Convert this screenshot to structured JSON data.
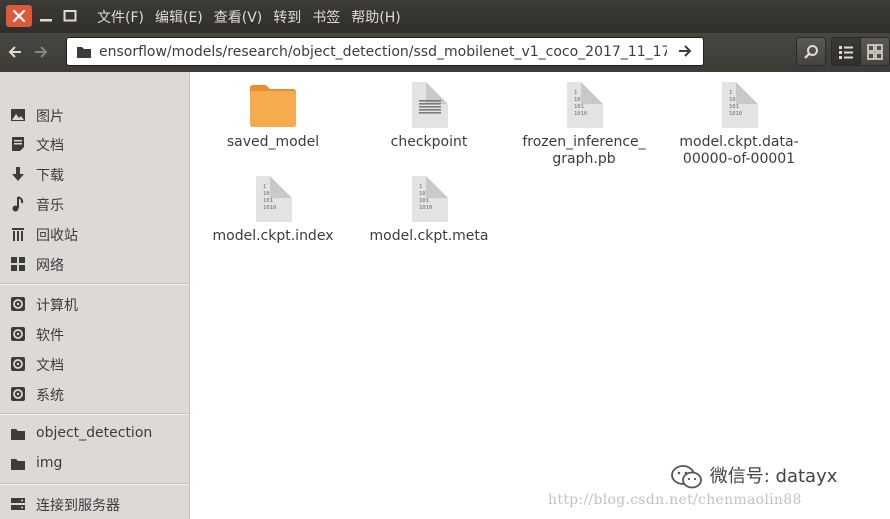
{
  "menu": [
    "文件(F)",
    "编辑(E)",
    "查看(V)",
    "转到",
    "书签",
    "帮助(H)"
  ],
  "location": {
    "value": "ensorflow/models/research/object_detection/ssd_mobilenet_v1_coco_2017_11_17"
  },
  "sidebar": {
    "places": [
      {
        "label": "图片",
        "icon": "pictures-icon"
      },
      {
        "label": "文档",
        "icon": "documents-icon"
      },
      {
        "label": "下载",
        "icon": "download-icon"
      },
      {
        "label": "音乐",
        "icon": "music-icon"
      },
      {
        "label": "回收站",
        "icon": "trash-icon"
      },
      {
        "label": "网络",
        "icon": "network-icon"
      }
    ],
    "devices": [
      {
        "label": "计算机",
        "icon": "drive-icon"
      },
      {
        "label": "软件",
        "icon": "drive-icon"
      },
      {
        "label": "文档",
        "icon": "drive-icon"
      },
      {
        "label": "系统",
        "icon": "drive-icon"
      }
    ],
    "bookmarks": [
      {
        "label": "object_detection",
        "icon": "folder-icon"
      },
      {
        "label": "img",
        "icon": "folder-icon"
      }
    ],
    "network": [
      {
        "label": "连接到服务器",
        "icon": "server-icon"
      }
    ]
  },
  "files": [
    {
      "name": "saved_model",
      "type": "folder"
    },
    {
      "name": "checkpoint",
      "type": "text"
    },
    {
      "name": "frozen_inference_\ngraph.pb",
      "type": "binary"
    },
    {
      "name": "model.ckpt.data-\n00000-of-00001",
      "type": "binary"
    },
    {
      "name": "model.ckpt.index",
      "type": "binary"
    },
    {
      "name": "model.ckpt.meta",
      "type": "binary"
    }
  ],
  "binary_glyph": "1\n10\n101\n1010",
  "watermark": {
    "text": "微信号: datayx",
    "url": "http://blog.csdn.net/chenmaolin88"
  },
  "colors": {
    "close": "#e0583c",
    "folder": "#f5a33c",
    "titlebar": "#3c3b37"
  }
}
